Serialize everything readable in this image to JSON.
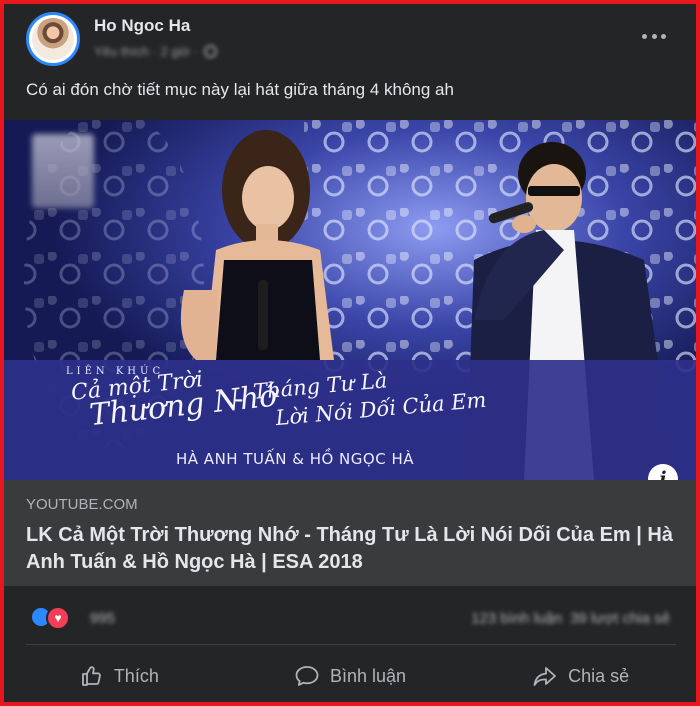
{
  "post": {
    "author": "Ho Ngoc Ha",
    "meta_time": "Yêu thích · 2 giờ ·",
    "text": "Có ai đón chờ tiết mục này lại hát giữa tháng 4 không ah"
  },
  "media": {
    "overlay_lien_khuc": "LIÊN KHÚC",
    "overlay_song1_line1": "Cả một Trời",
    "overlay_song1_line2": "Thương Nhớ",
    "overlay_dash": "-",
    "overlay_song2_line1": "Tháng Tư Là",
    "overlay_song2_line2": "Lời Nói Dối Của Em",
    "overlay_artists": "HÀ ANH TUẤN & HỒ NGỌC HÀ",
    "info_label": "i"
  },
  "link_preview": {
    "domain": "YOUTUBE.COM",
    "title": "LK Cả Một Trời Thương Nhớ - Tháng Tư Là Lời Nói Dối Của Em | Hà Anh Tuấn & Hồ Ngọc Hà | ESA 2018"
  },
  "reactions": {
    "count": "995",
    "comments": "123 bình luận",
    "shares": "39 lượt chia sẻ",
    "heart_glyph": "♥"
  },
  "actions": {
    "like_label": "Thích",
    "comment_label": "Bình luận",
    "share_label": "Chia sẻ"
  },
  "colors": {
    "frame_border": "#e8161d",
    "card_bg": "#242526",
    "link_bg": "#3a3b3c",
    "like_blue": "#2d88ff",
    "heart_red": "#f33e58"
  }
}
